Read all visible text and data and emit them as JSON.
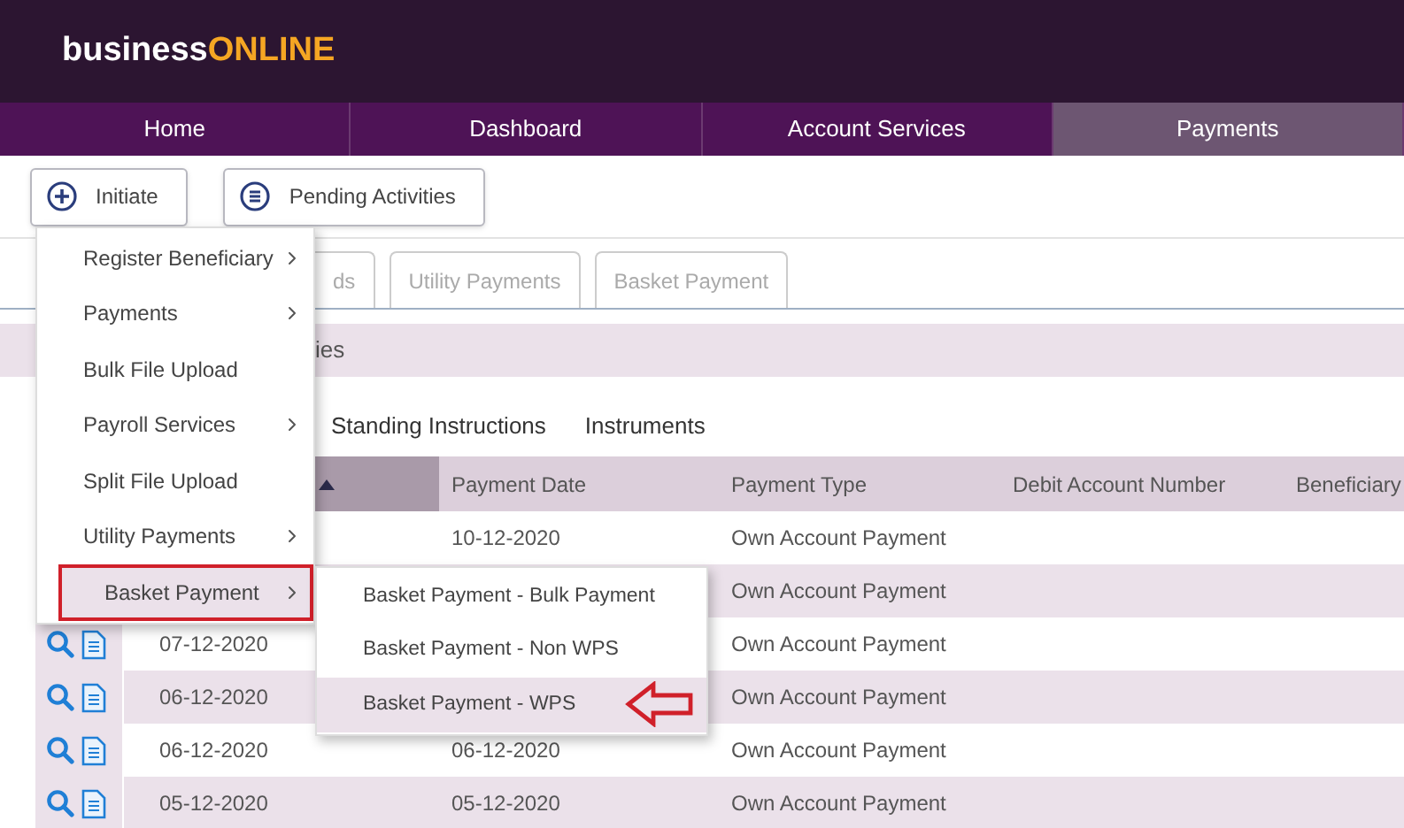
{
  "logo": {
    "prefix": "business",
    "suffix": "ONLINE"
  },
  "nav": [
    {
      "label": "Home",
      "selected": false
    },
    {
      "label": "Dashboard",
      "selected": false
    },
    {
      "label": "Account Services",
      "selected": false
    },
    {
      "label": "Payments",
      "selected": true
    }
  ],
  "toolbar": [
    {
      "label": "Initiate",
      "kind": "plus"
    },
    {
      "label": "Pending Activities",
      "kind": "list"
    }
  ],
  "tabs": [
    "ds",
    "Utility Payments",
    "Basket Payment"
  ],
  "section_title": "ies",
  "sub_tabs": [
    "Standing Instructions",
    "Instruments"
  ],
  "table": {
    "sort_ascending": true,
    "columns": [
      "Payment Date",
      "Payment Type",
      "Debit Account Number",
      "Beneficiary"
    ],
    "rows": [
      {
        "payment_date": "10-12-2020",
        "payment_type": "Own Account Payment"
      },
      {
        "payment_type": "Own Account Payment"
      },
      {
        "date": "07-12-2020",
        "payment_type": "Own Account Payment"
      },
      {
        "date": "06-12-2020",
        "payment_type": "Own Account Payment"
      },
      {
        "date": "06-12-2020",
        "payment_date": "06-12-2020",
        "payment_type": "Own Account Payment"
      },
      {
        "date": "05-12-2020",
        "payment_date": "05-12-2020",
        "payment_type": "Own Account Payment"
      }
    ]
  },
  "menu": [
    {
      "label": "Register Beneficiary",
      "submenu": true,
      "selected": false,
      "annotated": false
    },
    {
      "label": "Payments",
      "submenu": true,
      "selected": false,
      "annotated": false
    },
    {
      "label": "Bulk File Upload",
      "submenu": false,
      "selected": false,
      "annotated": false
    },
    {
      "label": "Payroll Services",
      "submenu": true,
      "selected": false,
      "annotated": false
    },
    {
      "label": "Split File Upload",
      "submenu": false,
      "selected": false,
      "annotated": false
    },
    {
      "label": "Utility Payments",
      "submenu": true,
      "selected": false,
      "annotated": false
    },
    {
      "label": "Basket Payment",
      "submenu": true,
      "selected": true,
      "annotated": true
    }
  ],
  "submenu": [
    {
      "label": "Basket Payment - Bulk Payment",
      "selected": false,
      "annotated": false
    },
    {
      "label": "Basket Payment - Non WPS",
      "selected": false,
      "annotated": false
    },
    {
      "label": "Basket Payment - WPS",
      "selected": true,
      "annotated": true
    }
  ]
}
